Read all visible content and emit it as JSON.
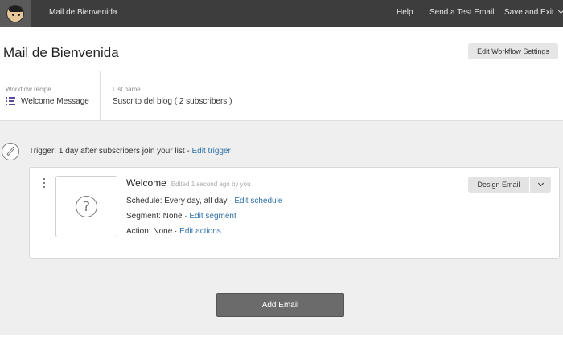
{
  "topbar": {
    "title": "Mail de Bienvenida",
    "help": "Help",
    "send_test": "Send a Test Email",
    "save_exit": "Save and Exit"
  },
  "header": {
    "title": "Mail de Bienvenida",
    "settings_button": "Edit Workflow Settings"
  },
  "info": {
    "recipe_label": "Workflow recipe",
    "recipe_value": "Welcome Message",
    "list_label": "List name",
    "list_value": "Suscrito del blog ( 2 subscribers )"
  },
  "trigger": {
    "label": "Trigger:",
    "text": "1 day after subscribers join your list -",
    "edit_link": "Edit trigger"
  },
  "email": {
    "title": "Welcome",
    "edited": "Edited 1 second ago by you",
    "schedule_label": "Schedule:",
    "schedule_value": "Every day, all day ·",
    "schedule_link": "Edit schedule",
    "segment_label": "Segment:",
    "segment_value": "None ·",
    "segment_link": "Edit segment",
    "action_label": "Action:",
    "action_value": "None ·",
    "action_link": "Edit actions",
    "design_button": "Design Email",
    "thumb_glyph": "?"
  },
  "add_button": "Add Email",
  "colors": {
    "topbar": "#3d3d3d",
    "link": "#3272a8",
    "page_bg": "#efefef",
    "add_button": "#6b6b6b",
    "list_icon": "#5b4aa0"
  }
}
